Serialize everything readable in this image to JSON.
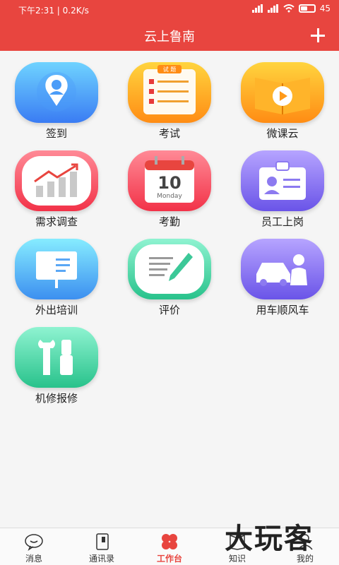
{
  "status": {
    "time": "下午2:31",
    "speed": "0.2K/s",
    "battery": "45"
  },
  "header": {
    "title": "云上鲁南"
  },
  "tiles": [
    {
      "label": "签到"
    },
    {
      "label": "考试",
      "badge": "试 题"
    },
    {
      "label": "微课云"
    },
    {
      "label": "需求调查"
    },
    {
      "label": "考勤",
      "day": "10",
      "weekday": "Monday"
    },
    {
      "label": "员工上岗"
    },
    {
      "label": "外出培训"
    },
    {
      "label": "评价"
    },
    {
      "label": "用车顺风车"
    },
    {
      "label": "机修报修"
    }
  ],
  "tabs": [
    {
      "label": "消息"
    },
    {
      "label": "通讯录"
    },
    {
      "label": "工作台",
      "active": true
    },
    {
      "label": "知识"
    },
    {
      "label": "我的"
    }
  ],
  "watermark": "大玩客",
  "colors": {
    "brand": "#e8453f",
    "tab_active": "#e8453f"
  }
}
